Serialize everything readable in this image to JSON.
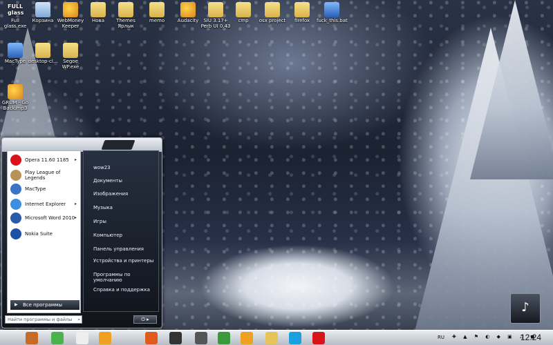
{
  "desktop": {
    "icons": [
      {
        "label": "Full glass.exe",
        "glyph_text": "FULL glass",
        "icon": "text-icon"
      },
      {
        "label": "Корзина",
        "icon": "recycle-bin-icon"
      },
      {
        "label": "WebMoney Keeper",
        "icon": "webmoney-icon"
      },
      {
        "label": "Нова",
        "icon": "folder-icon"
      },
      {
        "label": "Themes Ярлык",
        "icon": "folder-icon"
      },
      {
        "label": "memo",
        "icon": "folder-icon"
      },
      {
        "label": "Audacity",
        "icon": "audacity-icon"
      },
      {
        "label": "SIU 3.17+ Perb UI 0.43",
        "icon": "folder-icon"
      },
      {
        "label": "cmp",
        "icon": "folder-icon"
      },
      {
        "label": "osx project",
        "icon": "folder-icon"
      },
      {
        "label": "firefox",
        "icon": "folder-icon"
      },
      {
        "label": "fuck_this.bat",
        "icon": "bat-file-icon"
      },
      {
        "label": "MacType",
        "icon": "mactype-icon"
      },
      {
        "label": "desktop-cl...",
        "icon": "folder-icon"
      },
      {
        "label": "Segoe WP.exe",
        "icon": "folder-icon"
      },
      {
        "label": "GRUM - Go Back.mp3",
        "icon": "music-file-icon"
      }
    ]
  },
  "start_menu": {
    "programs": [
      {
        "label": "Opera 11.60 1185",
        "icon": "opera-icon",
        "color": "#d8141b",
        "has_arrow": true
      },
      {
        "label": "Play League of Legends",
        "icon": "lol-icon",
        "color": "#b9925a",
        "has_arrow": false
      },
      {
        "label": "MacType",
        "icon": "mactype-icon",
        "color": "#3a73c8",
        "has_arrow": false
      },
      {
        "label": "Internet Explorer",
        "icon": "ie-icon",
        "color": "#3f8fe0",
        "has_arrow": true
      },
      {
        "label": "Microsoft Word 2010",
        "icon": "word-icon",
        "color": "#2b5aa8",
        "has_arrow": true
      },
      {
        "label": "Nokia Suite",
        "icon": "nokia-icon",
        "color": "#1f4fa6",
        "has_arrow": false
      }
    ],
    "all_programs": "Все программы",
    "search_placeholder": "Найти программы и файлы",
    "right_links": [
      "wow23",
      "Документы",
      "Изображения",
      "Музыка",
      "Игры",
      "Компьютер",
      "Панель управления",
      "Устройства и принтеры",
      "Программы по умолчанию",
      "Справка и поддержка"
    ]
  },
  "taskbar": {
    "apps": [
      {
        "name": "start-orb",
        "color": "#c66a24"
      },
      {
        "name": "utorrent-like",
        "color": "#4bb34b"
      },
      {
        "name": "cursor",
        "color": "#eeeeee"
      },
      {
        "name": "aimp",
        "color": "#f0a020"
      },
      {
        "name": "firefox",
        "color": "#e05a1c"
      },
      {
        "name": "grum",
        "color": "#333333"
      },
      {
        "name": "steam",
        "color": "#555555"
      },
      {
        "name": "utorrent",
        "color": "#3a9a3a"
      },
      {
        "name": "aimp2",
        "color": "#f0a020"
      },
      {
        "name": "explorer",
        "color": "#e7c45a"
      },
      {
        "name": "skype",
        "color": "#1aa0e0"
      },
      {
        "name": "opera",
        "color": "#d8141b"
      }
    ],
    "lang": "RU",
    "time": "12:24"
  }
}
